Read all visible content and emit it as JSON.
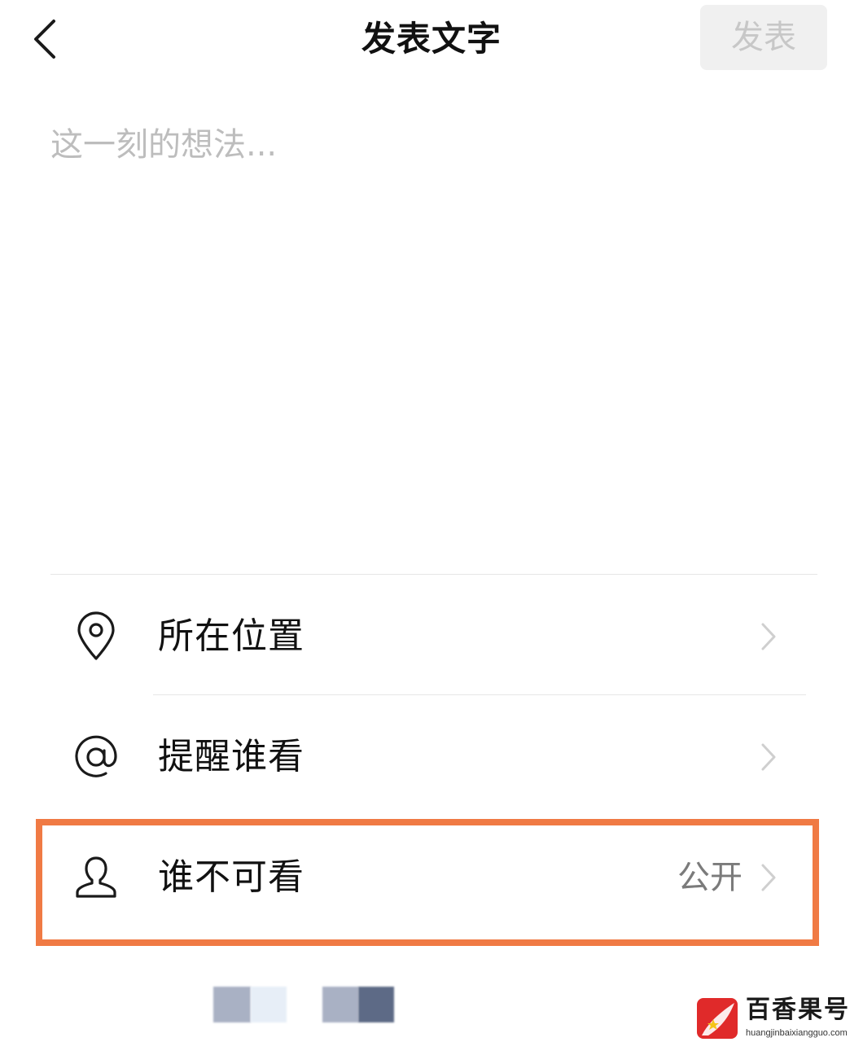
{
  "header": {
    "title": "发表文字",
    "publish_label": "发表",
    "back_icon": "chevron-left-icon"
  },
  "composer": {
    "placeholder": "这一刻的想法...",
    "value": ""
  },
  "options": [
    {
      "label": "所在位置",
      "icon": "location-pin-icon",
      "value": ""
    },
    {
      "label": "提醒谁看",
      "icon": "at-sign-icon",
      "value": ""
    },
    {
      "label": "谁不可看",
      "icon": "person-icon",
      "value": "公开"
    }
  ],
  "colors": {
    "highlight": "#f07a44",
    "publish_disabled_bg": "#f0f0f0",
    "publish_disabled_text": "#c7c7c7"
  },
  "watermark": {
    "title": "百香果号",
    "url": "huangjinbaixiangguo.com"
  }
}
